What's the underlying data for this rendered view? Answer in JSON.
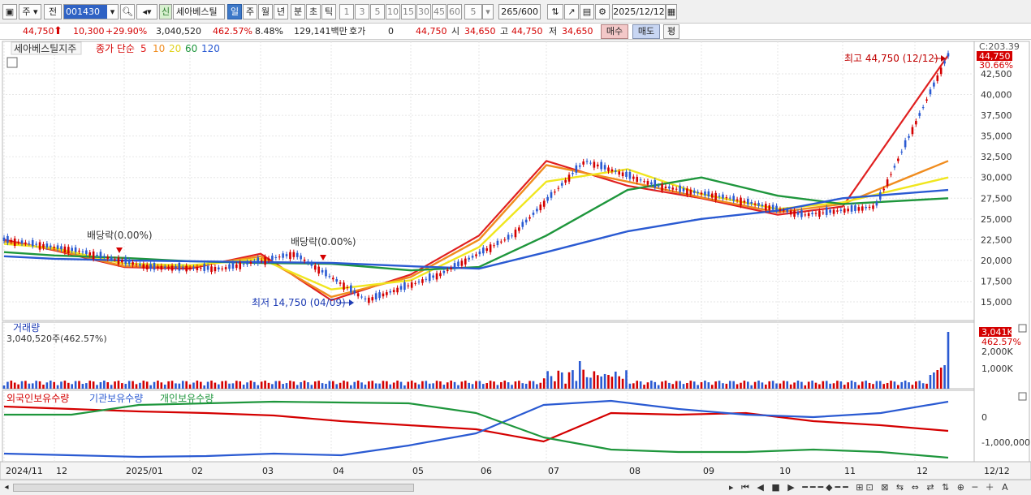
{
  "toolbar": {
    "period_type": "주",
    "prev_label": "전",
    "stock_code": "001430",
    "new_badge": "신",
    "stock_name": "세아베스틸",
    "tabs": [
      "일",
      "주",
      "월",
      "년",
      "분",
      "초",
      "틱"
    ],
    "active_tab": "일",
    "intervals": [
      "1",
      "3",
      "5",
      "10",
      "15",
      "30",
      "45",
      "60"
    ],
    "interval_value": "5",
    "count": "265",
    "count_total": "/600",
    "date": "2025/12/12"
  },
  "quote": {
    "price": "44,750",
    "change": "10,300",
    "change_pct": "+29.90%",
    "volume": "3,040,520",
    "volume_ratio": "462.57%",
    "turnover": "8.48%",
    "amount": "129,141백만",
    "bid_label": "호가",
    "bid_value": "0",
    "bid_price": "44,750",
    "open_label": "시",
    "open": "34,650",
    "high_label": "고",
    "high": "44,750",
    "low_label": "저",
    "low": "34,650",
    "buy": "매수",
    "sell": "매도",
    "avg": "평"
  },
  "price_panel": {
    "title": "세아베스틸지주",
    "ma_label": "종가 단순",
    "ma_periods": [
      {
        "label": "5",
        "color": "#e02020"
      },
      {
        "label": "10",
        "color": "#f08c1e"
      },
      {
        "label": "20",
        "color": "#f0e61e"
      },
      {
        "label": "60",
        "color": "#1e963c"
      },
      {
        "label": "120",
        "color": "#2a5ad2"
      }
    ],
    "y_ticks": [
      "42,500",
      "40,000",
      "37,500",
      "35,000",
      "32,500",
      "30,000",
      "27,500",
      "25,000",
      "22,500",
      "20,000",
      "17,500",
      "15,000"
    ],
    "top_label": "C:203.39",
    "last_price_badge": "44,750",
    "last_pct": "30.66%",
    "high_annotation": "최고 44,750 (12/12)",
    "low_annotation": "최저 14,750 (04/09)",
    "dividend_1": "배당락(0.00%)",
    "dividend_2": "배당락(0.00%)"
  },
  "volume_panel": {
    "title": "거래량",
    "value_label": "3,040,520주(462.57%)",
    "badge": "3,041K",
    "badge_pct": "462.57%",
    "y_ticks": [
      "2,000K",
      "1,000K"
    ]
  },
  "holdings_panel": {
    "legend": [
      {
        "label": "외국인보유수량",
        "color": "#d40000"
      },
      {
        "label": "기관보유수량",
        "color": "#2a5ad2"
      },
      {
        "label": "개인보유수량",
        "color": "#1e963c"
      }
    ],
    "y_ticks": [
      "0",
      "-1,000,000"
    ]
  },
  "x_axis": {
    "labels": [
      "2024/11",
      "12",
      "2025/01",
      "02",
      "03",
      "04",
      "05",
      "06",
      "07",
      "08",
      "09",
      "10",
      "11",
      "12"
    ],
    "right_label": "12/12"
  },
  "chart_data": {
    "type": "line",
    "title": "세아베스틸지주",
    "x": [
      "2024/11",
      "12",
      "2025/01",
      "02",
      "03",
      "04",
      "05",
      "06",
      "07",
      "08",
      "09",
      "10",
      "11",
      "12"
    ],
    "ylim": [
      14000,
      45000
    ],
    "series": [
      {
        "name": "5",
        "values": [
          22500,
          21200,
          19200,
          19000,
          20800,
          15200,
          18300,
          23000,
          32000,
          29000,
          27500,
          25500,
          26500,
          44750
        ]
      },
      {
        "name": "10",
        "values": [
          22300,
          21300,
          19300,
          19200,
          20500,
          15600,
          18000,
          22500,
          31500,
          29500,
          27600,
          25800,
          26800,
          32000
        ]
      },
      {
        "name": "20",
        "values": [
          22000,
          21500,
          19600,
          19400,
          20200,
          16500,
          17600,
          21600,
          29500,
          31000,
          28000,
          26200,
          27000,
          30000
        ]
      },
      {
        "name": "60",
        "values": [
          21000,
          20600,
          20300,
          19900,
          19700,
          19600,
          18800,
          19200,
          23000,
          28500,
          30000,
          27800,
          26800,
          27500
        ]
      },
      {
        "name": "120",
        "values": [
          20500,
          20200,
          20000,
          19900,
          19800,
          19700,
          19300,
          19000,
          21000,
          23500,
          25000,
          26000,
          27500,
          28500
        ]
      }
    ]
  }
}
